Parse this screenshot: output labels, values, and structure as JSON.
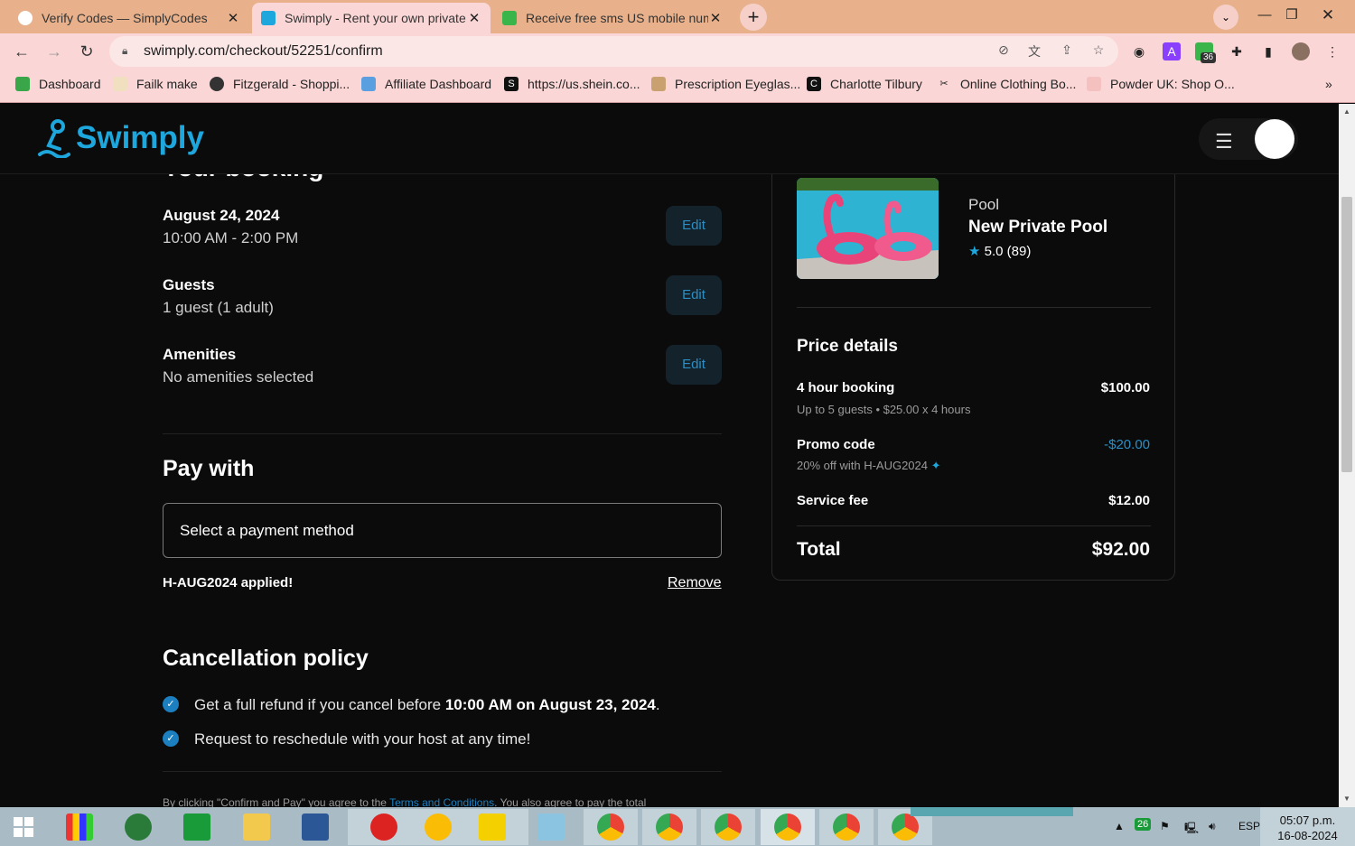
{
  "browser": {
    "tabs": [
      {
        "title": "Verify Codes — SimplyCodes",
        "active": false
      },
      {
        "title": "Swimply - Rent your own private",
        "active": true
      },
      {
        "title": "Receive free sms US mobile num",
        "active": false
      }
    ],
    "url": "swimply.com/checkout/52251/confirm",
    "ext_badge": "36",
    "bookmarks": [
      "Dashboard",
      "Failk make",
      "Fitzgerald - Shoppi...",
      "Affiliate Dashboard",
      "https://us.shein.co...",
      "Prescription Eyeglas...",
      "Charlotte Tilbury",
      "Online Clothing Bo...",
      "Powder UK: Shop O..."
    ],
    "bookmarks_more": "»"
  },
  "site": {
    "logo": "Swimply"
  },
  "booking": {
    "section_title": "Your booking",
    "date": "August 24, 2024",
    "time": "10:00 AM - 2:00 PM",
    "guests_label": "Guests",
    "guests_value": "1 guest (1 adult)",
    "amenities_label": "Amenities",
    "amenities_value": "No amenities selected",
    "edit_label": "Edit"
  },
  "payment": {
    "title": "Pay with",
    "select_label": "Select a payment method",
    "applied_text": "H-AUG2024 applied!",
    "remove_label": "Remove"
  },
  "cancellation": {
    "title": "Cancellation policy",
    "item1_prefix": "Get a full refund if you cancel before ",
    "item1_bold": "10:00 AM on August 23, 2024",
    "item1_suffix": ".",
    "item2": "Request to reschedule with your host at any time!"
  },
  "legal": {
    "prefix": "By clicking \"Confirm and Pay\" you agree to the ",
    "link": "Terms and Conditions",
    "suffix": ". You also agree to pay the total"
  },
  "listing": {
    "type": "Pool",
    "name": "New Private Pool",
    "rating": "5.0 (89)"
  },
  "price": {
    "title": "Price details",
    "booking_label": "4 hour booking",
    "booking_sub": "Up to 5 guests • $25.00 x 4 hours",
    "booking_amount": "$100.00",
    "promo_label": "Promo code",
    "promo_sub": "20% off with H-AUG2024",
    "promo_amount": "-$20.00",
    "service_label": "Service fee",
    "service_amount": "$12.00",
    "total_label": "Total",
    "total_amount": "$92.00"
  },
  "taskbar": {
    "tray_badge": "26",
    "lang": "ESP",
    "time": "05:07 p.m.",
    "date": "16-08-2024"
  },
  "colors": {
    "accent": "#1da7dd",
    "promo": "#2a8fc6"
  }
}
